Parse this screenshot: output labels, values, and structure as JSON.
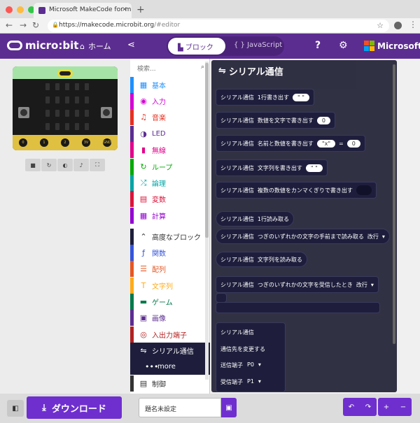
{
  "browser": {
    "tab_title": "Microsoft MakeCode for micro:bit",
    "url_host": "https://makecode.microbit.org",
    "url_path": "/#editor"
  },
  "header": {
    "logo_text": "micro:bit",
    "home_label": "ホーム",
    "blocks_label": "ブロック",
    "js_label": "JavaScript",
    "brand": "Microsoft"
  },
  "simulator": {
    "pins": [
      "0",
      "1",
      "2",
      "3V",
      "GND"
    ]
  },
  "toolbox": {
    "search_placeholder": "検索...",
    "categories": [
      {
        "label": "基本",
        "color": "#1e90ff"
      },
      {
        "label": "入力",
        "color": "#d400d4"
      },
      {
        "label": "音楽",
        "color": "#e63022"
      },
      {
        "label": "LED",
        "color": "#5c2d91"
      },
      {
        "label": "無線",
        "color": "#e3008c"
      },
      {
        "label": "ループ",
        "color": "#00aa00"
      },
      {
        "label": "論理",
        "color": "#00a4a6"
      },
      {
        "label": "変数",
        "color": "#dc143c"
      },
      {
        "label": "計算",
        "color": "#9400d3"
      },
      {
        "label": "高度なブロック",
        "color": "#1e1e3c"
      },
      {
        "label": "関数",
        "color": "#3455db"
      },
      {
        "label": "配列",
        "color": "#e65722"
      },
      {
        "label": "文字列",
        "color": "#ffab19"
      },
      {
        "label": "ゲーム",
        "color": "#007a4b"
      },
      {
        "label": "画像",
        "color": "#5c2d91"
      },
      {
        "label": "入出力端子",
        "color": "#b22222"
      },
      {
        "label": "シリアル通信",
        "color": "#1e1e3c"
      },
      {
        "label": "more",
        "color": "#1e1e3c"
      },
      {
        "label": "制御",
        "color": "#333333"
      }
    ]
  },
  "flyout": {
    "title": "シリアル通信",
    "prefix": "シリアル通信",
    "blocks": [
      {
        "text": "1行書き出す",
        "slot": "\" \""
      },
      {
        "text": "数値を文字で書き出す",
        "slot": "0"
      },
      {
        "text": "名前と数値を書き出す",
        "slot": "\"x\"",
        "eq": "=",
        "slot2": "0"
      },
      {
        "text": "文字列を書き出す",
        "slot": "\" \""
      },
      {
        "text": "複数の数値をカンマくぎりで書き出す"
      },
      {
        "text": "1行読み取る"
      },
      {
        "text": "つぎのいずれかの文字の手前まで読み取る",
        "dd": "改行"
      },
      {
        "text": "文字列を読み取る"
      },
      {
        "text": "つぎのいずれかの文字を受信したとき",
        "dd": "改行"
      }
    ],
    "redirect": {
      "line1": "シリアル通信",
      "line2": "通信先を変更する",
      "tx_label": "送信端子",
      "tx_value": "P0",
      "rx_label": "受信端子",
      "rx_value": "P1"
    }
  },
  "bottom": {
    "download_label": "ダウンロード",
    "project_name": "題名未設定"
  }
}
